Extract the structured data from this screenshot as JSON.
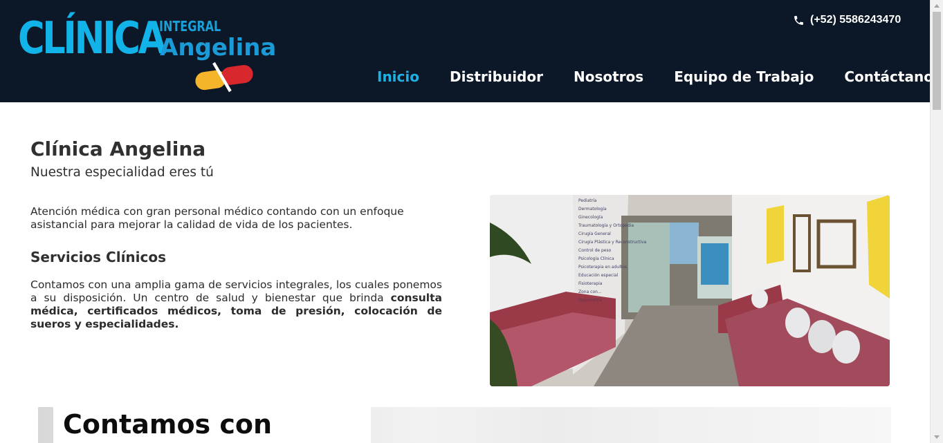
{
  "header": {
    "logo": {
      "main": "CLÍNICA",
      "integral": "INTEGRAL",
      "name": "Angelina"
    },
    "phone": "(+52) 5586243470",
    "phone_icon": "phone-icon",
    "nav": [
      {
        "label": "Inicio",
        "active": true
      },
      {
        "label": "Distribuidor",
        "active": false
      },
      {
        "label": "Nosotros",
        "active": false
      },
      {
        "label": "Equipo de Trabajo",
        "active": false
      },
      {
        "label": "Contáctanos",
        "active": false
      }
    ]
  },
  "main": {
    "title": "Clínica Angelina",
    "subtitle": "Nuestra especialidad eres tú",
    "intro": "Atención médica con gran personal médico contando con un enfoque asistancial para mejorar la calidad de vida de los pacientes.",
    "services": {
      "title": "Servicios Clínicos",
      "text_plain": "Contamos con una amplia gama de servicios integrales, los cuales ponemos a su disposición. Un centro de salud y bienestar que brinda",
      "text_bold": "consulta médica, certificados médicos, toma de presión, colocación de sueros y especialidades."
    },
    "photo_sign": [
      "Pediatría",
      "Dermatología",
      "Ginecología",
      "Traumatología y Ortopedia",
      "Cirugía General",
      "Cirugía Plástica y Reconstructiva",
      "Control de peso",
      "Psicología Clínica",
      "Psicoterapia en adultos",
      "Educación especial",
      "Fisioterapia",
      "Zona con...",
      "Optometría"
    ]
  },
  "banner": {
    "title": "Contamos con"
  },
  "colors": {
    "header_bg": "#0c1827",
    "accent": "#1eb1e6",
    "text": "#303030"
  }
}
